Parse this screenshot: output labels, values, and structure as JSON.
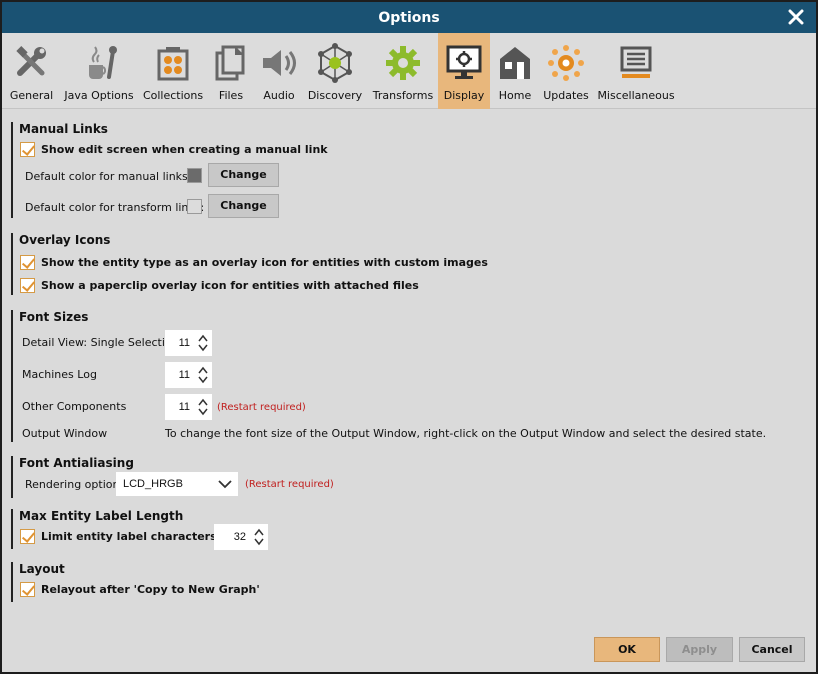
{
  "window": {
    "title": "Options"
  },
  "tabs": [
    {
      "label": "General",
      "icon": "tools-icon"
    },
    {
      "label": "Java Options",
      "icon": "java-icon"
    },
    {
      "label": "Collections",
      "icon": "collections-icon"
    },
    {
      "label": "Files",
      "icon": "files-icon"
    },
    {
      "label": "Audio",
      "icon": "speaker-icon"
    },
    {
      "label": "Discovery",
      "icon": "network-icon"
    },
    {
      "label": "Transforms",
      "icon": "gear-icon"
    },
    {
      "label": "Display",
      "icon": "monitor-icon",
      "active": true
    },
    {
      "label": "Home",
      "icon": "home-icon"
    },
    {
      "label": "Updates",
      "icon": "updates-icon"
    },
    {
      "label": "Miscellaneous",
      "icon": "misc-icon"
    }
  ],
  "manual_links": {
    "title": "Manual Links",
    "show_edit_label": "Show edit screen when creating a manual link",
    "manual_color_label": "Default color for manual links:",
    "manual_color": "#6b6b6b",
    "transform_color_label": "Default color for transform links:",
    "transform_color": "#dcdcdc",
    "change_label": "Change"
  },
  "overlay_icons": {
    "title": "Overlay Icons",
    "entity_type_label": "Show the entity type as an overlay icon for entities with custom images",
    "paperclip_label": "Show a paperclip overlay icon for entities with attached files"
  },
  "font_sizes": {
    "title": "Font Sizes",
    "detail_view_label": "Detail View: Single Selection",
    "detail_view_value": "11",
    "machines_log_label": "Machines Log",
    "machines_log_value": "11",
    "other_components_label": "Other Components",
    "other_components_value": "11",
    "restart_note": "(Restart required)",
    "output_window_label": "Output Window",
    "output_window_note": "To change the font size of the Output Window, right-click on the Output Window and select the desired state."
  },
  "font_antialiasing": {
    "title": "Font Antialiasing",
    "rendering_label": "Rendering options",
    "rendering_value": "LCD_HRGB",
    "restart_note": "(Restart required)"
  },
  "max_label": {
    "title": "Max Entity Label Length",
    "limit_label": "Limit entity label characters to",
    "limit_value": "32"
  },
  "layout": {
    "title": "Layout",
    "relayout_label": "Relayout after 'Copy to New Graph'"
  },
  "buttons": {
    "ok": "OK",
    "apply": "Apply",
    "cancel": "Cancel"
  },
  "colors": {
    "title_bar": "#1a5273",
    "active_tab": "#e8b77c",
    "accent": "#e09332"
  }
}
